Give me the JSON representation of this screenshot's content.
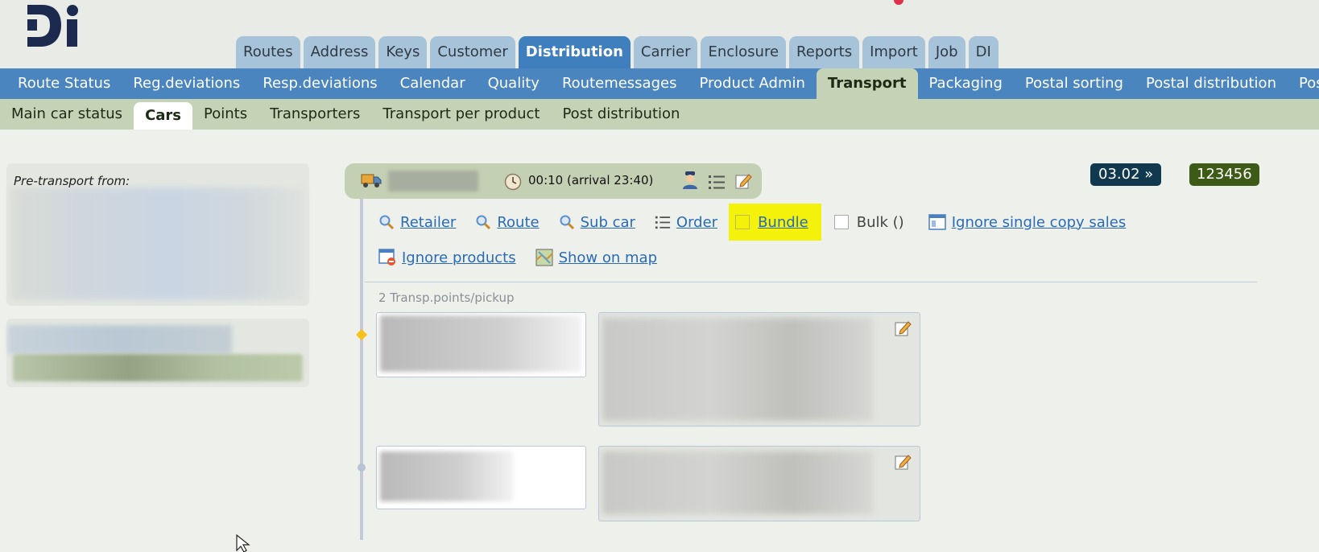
{
  "header": {
    "top_tabs": [
      {
        "label": "Routes"
      },
      {
        "label": "Address"
      },
      {
        "label": "Keys"
      },
      {
        "label": "Customer"
      },
      {
        "label": "Distribution",
        "active": true
      },
      {
        "label": "Carrier"
      },
      {
        "label": "Enclosure"
      },
      {
        "label": "Reports"
      },
      {
        "label": "Import"
      },
      {
        "label": "Job"
      },
      {
        "label": "DI"
      }
    ]
  },
  "nav2": [
    {
      "label": "Route Status"
    },
    {
      "label": "Reg.deviations"
    },
    {
      "label": "Resp.deviations"
    },
    {
      "label": "Calendar"
    },
    {
      "label": "Quality"
    },
    {
      "label": "Routemessages"
    },
    {
      "label": "Product Admin"
    },
    {
      "label": "Transport",
      "active": true
    },
    {
      "label": "Packaging"
    },
    {
      "label": "Postal sorting"
    },
    {
      "label": "Postal distribution"
    },
    {
      "label": "Postal"
    }
  ],
  "nav3": [
    {
      "label": "Main car status"
    },
    {
      "label": "Cars",
      "active": true
    },
    {
      "label": "Points"
    },
    {
      "label": "Transporters"
    },
    {
      "label": "Transport per product"
    },
    {
      "label": "Post distribution"
    }
  ],
  "left_panel": {
    "pre_transport_label": "Pre-transport from:"
  },
  "car": {
    "time": "00:10 (arrival 23:40)"
  },
  "badges": {
    "date": "03.02 »",
    "number": "123456"
  },
  "actions": {
    "retailer": "Retailer",
    "route": "Route",
    "sub_car": "Sub car",
    "order": "Order",
    "bundle": "Bundle",
    "bulk": "Bulk ()",
    "ignore_single": "Ignore single copy sales",
    "ignore_products": "Ignore products",
    "show_on_map": "Show on map"
  },
  "points_label": "2 Transp.points/pickup",
  "colors": {
    "accent": "#4a85bf",
    "tab_active": "#3f7fbd",
    "highlight": "#f4f20a",
    "badge_date": "#103950",
    "badge_num": "#3d5b16",
    "sub_nav": "#c4d2b6"
  }
}
